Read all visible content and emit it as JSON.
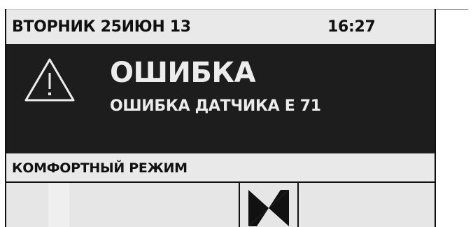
{
  "status_bar": {
    "date": "ВТОРНИК 25ИЮН 13",
    "time": "16:27"
  },
  "error": {
    "icon": "warning-icon",
    "title": "ОШИБКА",
    "detail": "ОШИБКА ДАТЧИКА Е 71"
  },
  "mode": {
    "label": "КОМФОРТНЫЙ РЕЖИМ"
  },
  "lower": {
    "icon": "fan-icon"
  },
  "colors": {
    "panel_dark": "#1d1d1d",
    "panel_light": "#e9e9e9",
    "text_light": "#ececec",
    "text_dark": "#111111"
  }
}
